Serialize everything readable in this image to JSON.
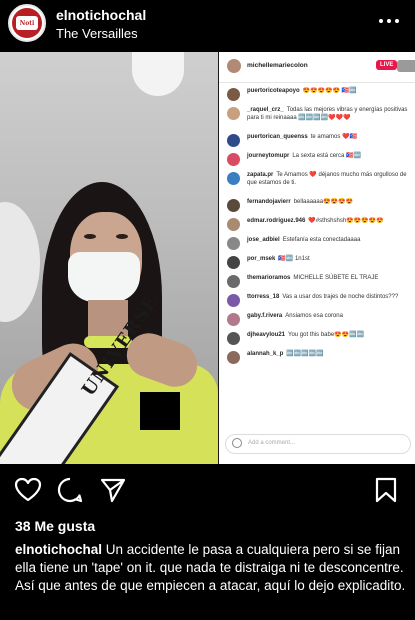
{
  "post": {
    "username": "elnotichochal",
    "location": "The Versailles",
    "likes": "38 Me gusta",
    "caption_user": "elnotichochal",
    "caption_text": "Un accidente le pasa a cualquiera pero si se fijan ella tiene un 'tape' on it. que nada te distraiga ni te desconcentre. Así que antes de que empiecen a atacar, aquí lo dejo explicadito."
  },
  "video": {
    "sash_text": "UNIVERSE"
  },
  "live": {
    "host": "michellemariecolon",
    "live_label": "LIVE",
    "input_placeholder": "Add a comment...",
    "comments": [
      {
        "user": "puertoricoteapoyo",
        "text": "😍😍😍😍😍 🇵🇷🔤",
        "color": "#7a5a45"
      },
      {
        "user": "_raquel_crz_",
        "text": "Todas las mejores vibras y energías positivas para ti mi reinaaaa 🔤🔤🔤🔤❤️❤️❤️",
        "color": "#c9a07f"
      },
      {
        "user": "puertorican_queenss",
        "text": "te amamos ❤️🇵🇷",
        "color": "#2f4a8a"
      },
      {
        "user": "journeytomupr",
        "text": "La sexta está cerca 🇵🇷🔤",
        "color": "#d94a63"
      },
      {
        "user": "zapata.pr",
        "text": "Te Amamos ❤️ déjanos mucho más orgulloso de que estamos de ti.",
        "color": "#3a7fc1"
      },
      {
        "user": "fernandojavierr",
        "text": "bellaaaaaa😍😍😍😍",
        "color": "#5a4a3a"
      },
      {
        "user": "edmar.rodriguez.946",
        "text": "❤️#sthshshsh😍😍😍😍😍",
        "color": "#a88b70"
      },
      {
        "user": "jose_adbiel",
        "text": "Estefanía esta conectadaaaa",
        "color": "#888888"
      },
      {
        "user": "por_msek",
        "text": "🇵🇷🔤 1n1st",
        "color": "#444444"
      },
      {
        "user": "themarioramos",
        "text": "MICHELLE SÚBETE EL TRAJE",
        "color": "#6a6a6a"
      },
      {
        "user": "ttorress_18",
        "text": "Vas a usar dos trajes de noche distintos???",
        "color": "#7a5aa8"
      },
      {
        "user": "gaby.f.rivera",
        "text": "Ansiamos esa corona",
        "color": "#b07a8a"
      },
      {
        "user": "djheavylou21",
        "text": "You got this babe😍😍🔤🔤",
        "color": "#555555"
      },
      {
        "user": "alannah_k_p",
        "text": "🔤🔤🔤🔤🔤",
        "color": "#8a6a5a"
      }
    ]
  },
  "colors": {
    "background": "#000000",
    "text": "#ffffff",
    "live": "#e6174a"
  },
  "icons": [
    "more-icon",
    "heart-icon",
    "comment-icon",
    "share-icon",
    "bookmark-icon"
  ]
}
